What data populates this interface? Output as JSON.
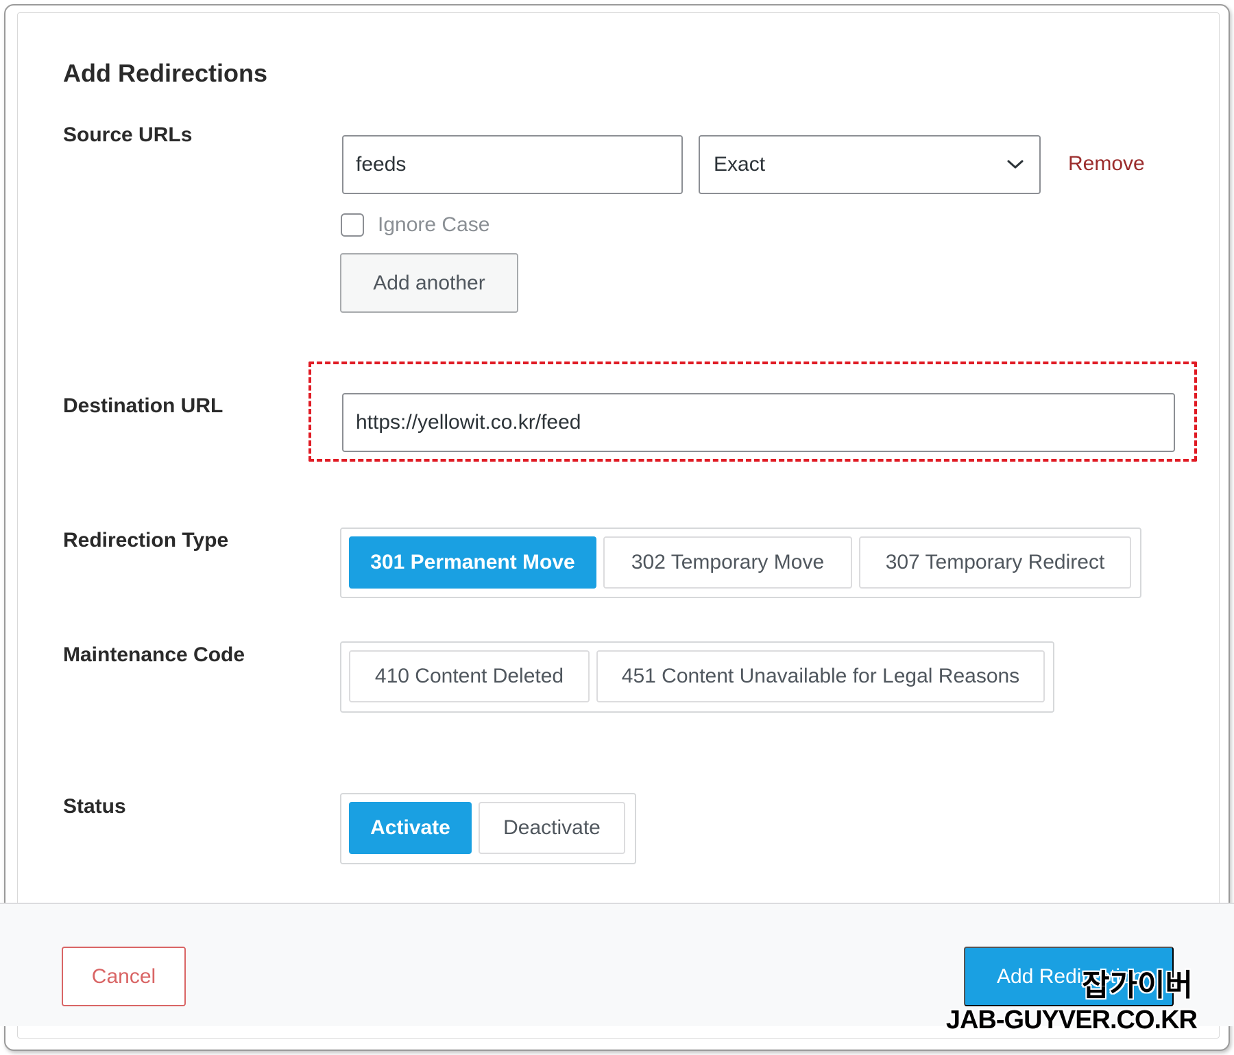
{
  "form": {
    "title": "Add Redirections",
    "source": {
      "label": "Source URLs",
      "url_value": "feeds",
      "match_type": "Exact",
      "remove_label": "Remove",
      "ignore_case_label": "Ignore Case",
      "ignore_case_checked": false,
      "add_another_label": "Add another"
    },
    "destination": {
      "label": "Destination URL",
      "url_value": "https://yellowit.co.kr/feed"
    },
    "redirection_type": {
      "label": "Redirection Type",
      "options": [
        "301 Permanent Move",
        "302 Temporary Move",
        "307 Temporary Redirect"
      ],
      "selected": "301 Permanent Move"
    },
    "maintenance_code": {
      "label": "Maintenance Code",
      "options": [
        "410 Content Deleted",
        "451 Content Unavailable for Legal Reasons"
      ],
      "selected": null
    },
    "status": {
      "label": "Status",
      "options": [
        "Activate",
        "Deactivate"
      ],
      "selected": "Activate"
    }
  },
  "footer": {
    "cancel_label": "Cancel",
    "submit_label": "Add Redirection"
  },
  "watermark": {
    "korean": "잡가이버",
    "latin": "JAB-GUYVER.CO.KR"
  },
  "colors": {
    "accent": "#1aa0e2",
    "danger": "#9b2c2c",
    "cancel": "#d96565",
    "highlight_dashes": "#e01b24"
  },
  "icons": {
    "select_chevron": "chevron-down-icon"
  }
}
